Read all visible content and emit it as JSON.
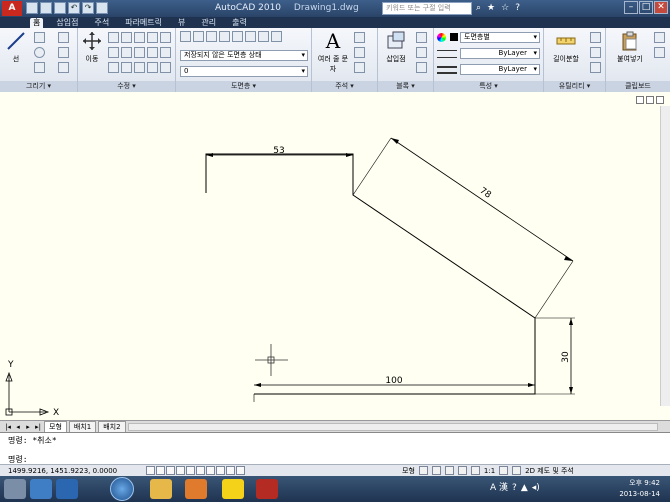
{
  "title": {
    "app": "AutoCAD 2010",
    "document": "Drawing1.dwg",
    "search_placeholder": "키워드 또는 구절 입력",
    "app_logo": "A"
  },
  "tabs": [
    "홈",
    "삽입점",
    "주석",
    "파라메트릭",
    "뷰",
    "관리",
    "출력"
  ],
  "ribbon": {
    "draw": {
      "line_label": "선",
      "panel_label": "그리기 ▾"
    },
    "modify": {
      "move_label": "이동",
      "panel_label": "수정 ▾"
    },
    "layers": {
      "state_combo": "저장되지 않은 도면층 상태",
      "layer_combo": "0",
      "panel_label": "도면층 ▾"
    },
    "annotation": {
      "text_label": "여러 줄 문자",
      "text_glyph": "A",
      "panel_label": "주석 ▾"
    },
    "block": {
      "insert_label": "삽입점",
      "panel_label": "블록 ▾"
    },
    "properties": {
      "color_combo": "도면층별",
      "linetype_combo": "ByLayer",
      "lineweight_combo": "ByLayer",
      "panel_label": "특성 ▾"
    },
    "utilities": {
      "measure_label": "길이분할",
      "panel_label": "유틸리티 ▾"
    },
    "clipboard": {
      "paste_label": "붙여넣기",
      "panel_label": "클립보드"
    }
  },
  "drawing": {
    "dimensions": [
      "53",
      "78",
      "30",
      "100"
    ],
    "ucs": {
      "x_label": "X",
      "y_label": "Y"
    }
  },
  "layout_tabs": [
    "모형",
    "배치1",
    "배치2"
  ],
  "command": {
    "line1": "명령: *취소*",
    "line2": "명령:"
  },
  "status": {
    "coords": "1499.9216, 1451.9223, 0.0000",
    "model_label": "모형",
    "scale": "1:1",
    "workspace": "2D 제도 및 주석"
  },
  "taskbar": {
    "time": "오후 9:42",
    "date": "2013-08-14",
    "ime": "A 漢"
  },
  "colors": {
    "canvas": "#fffff2",
    "titlebar": "#2a4468",
    "ribbon": "#dfe5ee"
  }
}
